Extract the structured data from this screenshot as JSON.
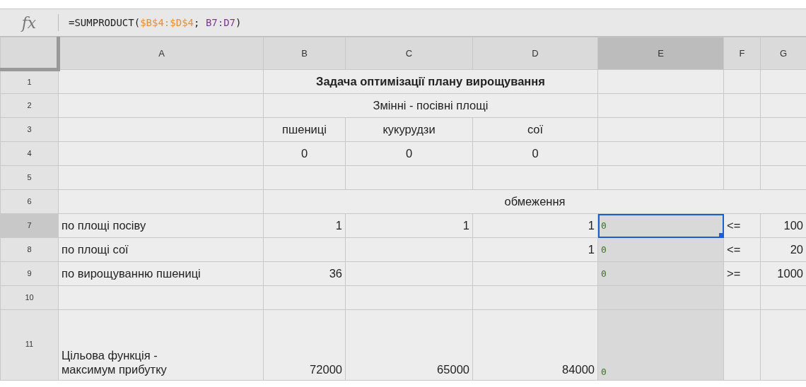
{
  "formula_bar": {
    "fx": "fx",
    "parts": [
      {
        "text": "=SUMPRODUCT(",
        "color": "#222222"
      },
      {
        "text": "$B$4:$D$4",
        "color": "#e69138"
      },
      {
        "text": "; ",
        "color": "#222222"
      },
      {
        "text": "B7:D7",
        "color": "#7e3794"
      },
      {
        "text": ")",
        "color": "#222222"
      }
    ]
  },
  "columns": [
    {
      "label": "A",
      "selected": false
    },
    {
      "label": "B",
      "selected": false
    },
    {
      "label": "C",
      "selected": false
    },
    {
      "label": "D",
      "selected": false
    },
    {
      "label": "E",
      "selected": true
    },
    {
      "label": "F",
      "selected": false
    },
    {
      "label": "G",
      "selected": false
    }
  ],
  "rows": [
    {
      "label": "1",
      "selected": false,
      "cells": [
        {
          "selected": false,
          "highlighted": false
        },
        {
          "text": "Задача оптимізації плану вирощування",
          "kind": "title",
          "merged": true,
          "selected": false,
          "highlighted": false
        },
        {
          "selected": false,
          "highlighted": false
        },
        {
          "selected": false,
          "highlighted": false
        },
        {
          "selected": false,
          "highlighted": false
        }
      ]
    },
    {
      "label": "2",
      "selected": false,
      "cells": [
        {
          "selected": false,
          "highlighted": false
        },
        {
          "text": "Змінні - посівні площі",
          "kind": "heading",
          "merged": true,
          "selected": false,
          "highlighted": false
        },
        {
          "selected": false,
          "highlighted": false
        },
        {
          "selected": false,
          "highlighted": false
        },
        {
          "selected": false,
          "highlighted": false
        }
      ]
    },
    {
      "label": "3",
      "selected": false,
      "cells": [
        {
          "selected": false,
          "highlighted": false
        },
        {
          "text": "пшениці",
          "kind": "heading",
          "selected": false,
          "highlighted": false
        },
        {
          "text": "кукурудзи",
          "kind": "heading",
          "selected": false,
          "highlighted": false
        },
        {
          "text": "сої",
          "kind": "heading",
          "selected": false,
          "highlighted": false
        },
        {
          "selected": false,
          "highlighted": false
        },
        {
          "selected": false,
          "highlighted": false
        },
        {
          "selected": false,
          "highlighted": false
        }
      ]
    },
    {
      "label": "4",
      "selected": false,
      "cells": [
        {
          "selected": false,
          "highlighted": false
        },
        {
          "text": "0",
          "kind": "heading",
          "selected": false,
          "highlighted": false
        },
        {
          "text": "0",
          "kind": "heading",
          "selected": false,
          "highlighted": false
        },
        {
          "text": "0",
          "kind": "heading",
          "selected": false,
          "highlighted": false
        },
        {
          "selected": false,
          "highlighted": false
        },
        {
          "selected": false,
          "highlighted": false
        },
        {
          "selected": false,
          "highlighted": false
        }
      ]
    },
    {
      "label": "5",
      "selected": false,
      "cells": [
        {
          "selected": false,
          "highlighted": false
        },
        {
          "selected": false,
          "highlighted": false
        },
        {
          "selected": false,
          "highlighted": false
        },
        {
          "selected": false,
          "highlighted": false
        },
        {
          "selected": false,
          "highlighted": false
        },
        {
          "selected": false,
          "highlighted": false
        },
        {
          "selected": false,
          "highlighted": false
        }
      ]
    },
    {
      "label": "6",
      "selected": false,
      "cells": [
        {
          "selected": false,
          "highlighted": false
        },
        {
          "text": "обмеження",
          "kind": "heading",
          "merged": true,
          "selected": false,
          "highlighted": false
        }
      ]
    },
    {
      "label": "7",
      "selected": true,
      "cells": [
        {
          "text": "по площі посіву",
          "kind": "text",
          "selected": false,
          "highlighted": false
        },
        {
          "text": "1",
          "kind": "number",
          "selected": false,
          "highlighted": false
        },
        {
          "text": "1",
          "kind": "number",
          "selected": false,
          "highlighted": false
        },
        {
          "text": "1",
          "kind": "number",
          "selected": false,
          "highlighted": false
        },
        {
          "text": "0",
          "kind": "formula",
          "selected": true,
          "highlighted": true
        },
        {
          "text": "<=",
          "kind": "text",
          "selected": false,
          "highlighted": false
        },
        {
          "text": "100",
          "kind": "number",
          "selected": false,
          "highlighted": false
        }
      ]
    },
    {
      "label": "8",
      "selected": false,
      "cells": [
        {
          "text": "по площі сої",
          "kind": "text",
          "selected": false,
          "highlighted": false
        },
        {
          "selected": false,
          "highlighted": false
        },
        {
          "selected": false,
          "highlighted": false
        },
        {
          "text": "1",
          "kind": "number",
          "selected": false,
          "highlighted": false
        },
        {
          "text": "0",
          "kind": "formula",
          "selected": false,
          "highlighted": true
        },
        {
          "text": "<=",
          "kind": "text",
          "selected": false,
          "highlighted": false
        },
        {
          "text": "20",
          "kind": "number",
          "selected": false,
          "highlighted": false
        }
      ]
    },
    {
      "label": "9",
      "selected": false,
      "cells": [
        {
          "text": "по вирощуванню пшениці",
          "kind": "text",
          "selected": false,
          "highlighted": false
        },
        {
          "text": "36",
          "kind": "number",
          "selected": false,
          "highlighted": false
        },
        {
          "selected": false,
          "highlighted": false
        },
        {
          "selected": false,
          "highlighted": false
        },
        {
          "text": "0",
          "kind": "formula",
          "selected": false,
          "highlighted": true
        },
        {
          "text": ">=",
          "kind": "text",
          "selected": false,
          "highlighted": false
        },
        {
          "text": "1000",
          "kind": "number",
          "selected": false,
          "highlighted": false
        }
      ]
    },
    {
      "label": "10",
      "selected": false,
      "cells": [
        {
          "selected": false,
          "highlighted": false
        },
        {
          "selected": false,
          "highlighted": false
        },
        {
          "selected": false,
          "highlighted": false
        },
        {
          "selected": false,
          "highlighted": false
        },
        {
          "selected": false,
          "highlighted": true
        },
        {
          "selected": false,
          "highlighted": false
        },
        {
          "selected": false,
          "highlighted": false
        }
      ]
    },
    {
      "label": "11",
      "selected": false,
      "cells": [
        {
          "text": "Цільова функція - максимум прибутку",
          "kind": "text",
          "selected": false,
          "highlighted": false
        },
        {
          "text": "72000",
          "kind": "number",
          "selected": false,
          "highlighted": false
        },
        {
          "text": "65000",
          "kind": "number",
          "selected": false,
          "highlighted": false
        },
        {
          "text": "84000",
          "kind": "number",
          "selected": false,
          "highlighted": false
        },
        {
          "text": "0",
          "kind": "formula",
          "selected": false,
          "highlighted": true
        },
        {
          "selected": false,
          "highlighted": false
        },
        {
          "selected": false,
          "highlighted": false
        }
      ]
    }
  ]
}
